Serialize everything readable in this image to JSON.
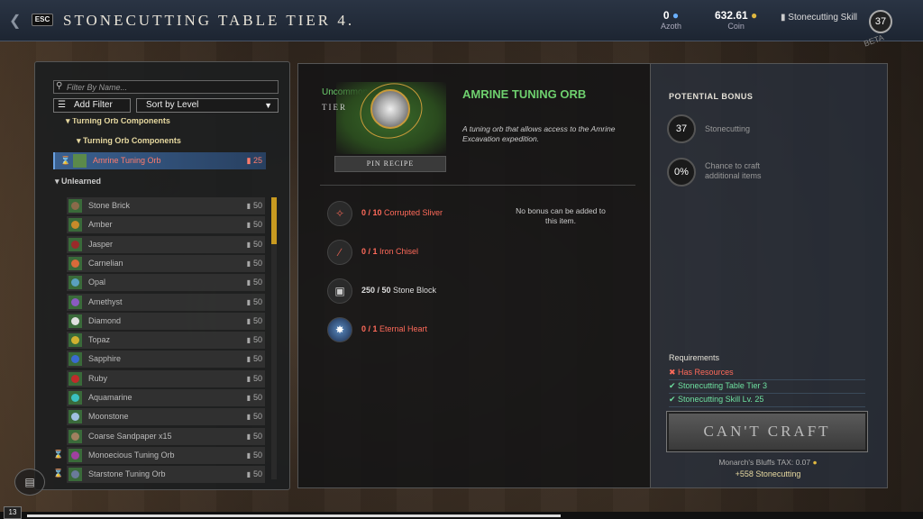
{
  "header": {
    "title": "STONECUTTING TABLE TIER 4.",
    "esc_label": "ESC",
    "azoth_value": "0",
    "azoth_label": "Azoth",
    "coin_value": "632.61",
    "coin_label": "Coin",
    "skill_label": "Stonecutting Skill",
    "skill_level": "37",
    "beta_label": "BETA"
  },
  "left_panel": {
    "filter_placeholder": "Filter By Name...",
    "add_filter_label": "Add Filter",
    "sort_label": "Sort by Level",
    "category_top": "Turning Orb Components",
    "subcategory": "Turning Orb Components",
    "selected_recipe": {
      "name": "Amrine Tuning Orb",
      "cost": "25"
    },
    "unlearned_label": "Unlearned",
    "recipes": [
      {
        "name": "Stone Brick",
        "cost": "50"
      },
      {
        "name": "Amber",
        "cost": "50"
      },
      {
        "name": "Jasper",
        "cost": "50"
      },
      {
        "name": "Carnelian",
        "cost": "50"
      },
      {
        "name": "Opal",
        "cost": "50"
      },
      {
        "name": "Amethyst",
        "cost": "50"
      },
      {
        "name": "Diamond",
        "cost": "50"
      },
      {
        "name": "Topaz",
        "cost": "50"
      },
      {
        "name": "Sapphire",
        "cost": "50"
      },
      {
        "name": "Ruby",
        "cost": "50"
      },
      {
        "name": "Aquamarine",
        "cost": "50"
      },
      {
        "name": "Moonstone",
        "cost": "50"
      },
      {
        "name": "Coarse Sandpaper x15",
        "cost": "50"
      },
      {
        "name": "Monoecious Tuning Orb",
        "cost": "50"
      },
      {
        "name": "Starstone Tuning Orb",
        "cost": "50"
      }
    ]
  },
  "item": {
    "rarity": "Uncommon",
    "tier_label": "TIER",
    "name": "AMRINE TUNING ORB",
    "description": "A tuning orb that allows access to the Amrine Excavation expedition.",
    "pin_label": "PIN RECIPE"
  },
  "ingredients": [
    {
      "have": "0",
      "need": "10",
      "name": "Corrupted Sliver",
      "met": false,
      "icon": "sliver-icon"
    },
    {
      "have": "0",
      "need": "1",
      "name": "Iron Chisel",
      "met": false,
      "icon": "chisel-icon"
    },
    {
      "have": "250",
      "need": "50",
      "name": "Stone Block",
      "met": true,
      "icon": "stone-block-icon"
    },
    {
      "have": "0",
      "need": "1",
      "name": "Eternal Heart",
      "met": false,
      "icon": "heart-icon"
    }
  ],
  "bonus_note": "No bonus can be added to this item.",
  "potential_bonus": {
    "title": "POTENTIAL BONUS",
    "skill_value": "37",
    "skill_label": "Stonecutting",
    "chance_value": "0%",
    "chance_label": "Chance to craft additional items"
  },
  "requirements": {
    "title": "Requirements",
    "items": [
      {
        "text": "Has Resources",
        "met": false
      },
      {
        "text": "Stonecutting Table Tier 3",
        "met": true
      },
      {
        "text": "Stonecutting Skill Lv. 25",
        "met": true
      }
    ]
  },
  "craft_button": "CAN'T CRAFT",
  "tax_text": "Monarch's Bluffs TAX: 0.07",
  "xp_text": "+558 Stonecutting",
  "player_level": "13",
  "colors": {
    "accent_green": "#6ed06e",
    "need_red": "#ff6a5a",
    "ok_green": "#6ee0a0",
    "gold": "#e7d9a0"
  }
}
